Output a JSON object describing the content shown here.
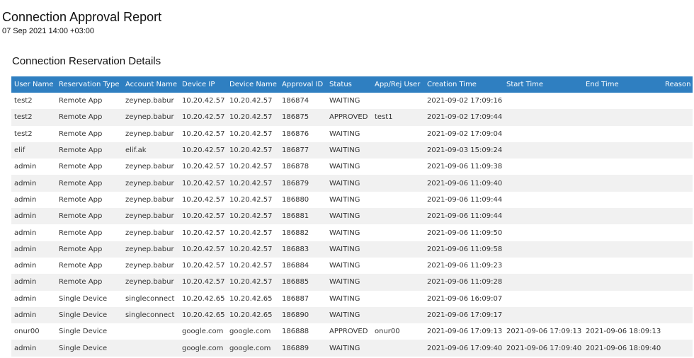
{
  "report": {
    "title": "Connection Approval Report",
    "date": "07 Sep 2021 14:00 +03:00"
  },
  "section": {
    "title": "Connection Reservation Details"
  },
  "table": {
    "columns": [
      "User Name",
      "Reservation Type",
      "Account Name",
      "Device IP",
      "Device Name",
      "Approval ID",
      "Status",
      "App/Rej User",
      "Creation Time",
      "Start Time",
      "End Time",
      "Reason"
    ],
    "rows": [
      [
        "test2",
        "Remote App",
        "zeynep.babur",
        "10.20.42.57",
        "10.20.42.57",
        "186874",
        "WAITING",
        "",
        "2021-09-02 17:09:16",
        "",
        "",
        ""
      ],
      [
        "test2",
        "Remote App",
        "zeynep.babur",
        "10.20.42.57",
        "10.20.42.57",
        "186875",
        "APPROVED",
        "test1",
        "2021-09-02 17:09:44",
        "",
        "",
        ""
      ],
      [
        "test2",
        "Remote App",
        "zeynep.babur",
        "10.20.42.57",
        "10.20.42.57",
        "186876",
        "WAITING",
        "",
        "2021-09-02 17:09:04",
        "",
        "",
        ""
      ],
      [
        "elif",
        "Remote App",
        "elif.ak",
        "10.20.42.57",
        "10.20.42.57",
        "186877",
        "WAITING",
        "",
        "2021-09-03 15:09:24",
        "",
        "",
        ""
      ],
      [
        "admin",
        "Remote App",
        "zeynep.babur",
        "10.20.42.57",
        "10.20.42.57",
        "186878",
        "WAITING",
        "",
        "2021-09-06 11:09:38",
        "",
        "",
        ""
      ],
      [
        "admin",
        "Remote App",
        "zeynep.babur",
        "10.20.42.57",
        "10.20.42.57",
        "186879",
        "WAITING",
        "",
        "2021-09-06 11:09:40",
        "",
        "",
        ""
      ],
      [
        "admin",
        "Remote App",
        "zeynep.babur",
        "10.20.42.57",
        "10.20.42.57",
        "186880",
        "WAITING",
        "",
        "2021-09-06 11:09:44",
        "",
        "",
        ""
      ],
      [
        "admin",
        "Remote App",
        "zeynep.babur",
        "10.20.42.57",
        "10.20.42.57",
        "186881",
        "WAITING",
        "",
        "2021-09-06 11:09:44",
        "",
        "",
        ""
      ],
      [
        "admin",
        "Remote App",
        "zeynep.babur",
        "10.20.42.57",
        "10.20.42.57",
        "186882",
        "WAITING",
        "",
        "2021-09-06 11:09:50",
        "",
        "",
        ""
      ],
      [
        "admin",
        "Remote App",
        "zeynep.babur",
        "10.20.42.57",
        "10.20.42.57",
        "186883",
        "WAITING",
        "",
        "2021-09-06 11:09:58",
        "",
        "",
        ""
      ],
      [
        "admin",
        "Remote App",
        "zeynep.babur",
        "10.20.42.57",
        "10.20.42.57",
        "186884",
        "WAITING",
        "",
        "2021-09-06 11:09:23",
        "",
        "",
        ""
      ],
      [
        "admin",
        "Remote App",
        "zeynep.babur",
        "10.20.42.57",
        "10.20.42.57",
        "186885",
        "WAITING",
        "",
        "2021-09-06 11:09:28",
        "",
        "",
        ""
      ],
      [
        "admin",
        "Single Device",
        "singleconnect",
        "10.20.42.65",
        "10.20.42.65",
        "186887",
        "WAITING",
        "",
        "2021-09-06 16:09:07",
        "",
        "",
        ""
      ],
      [
        "admin",
        "Single Device",
        "singleconnect",
        "10.20.42.65",
        "10.20.42.65",
        "186890",
        "WAITING",
        "",
        "2021-09-06 17:09:17",
        "",
        "",
        ""
      ],
      [
        "onur00",
        "Single Device",
        "",
        "google.com",
        "google.com",
        "186888",
        "APPROVED",
        "onur00",
        "2021-09-06 17:09:13",
        "2021-09-06 17:09:13",
        "2021-09-06 18:09:13",
        ""
      ],
      [
        "admin",
        "Single Device",
        "",
        "google.com",
        "google.com",
        "186889",
        "WAITING",
        "",
        "2021-09-06 17:09:40",
        "2021-09-06 17:09:40",
        "2021-09-06 18:09:40",
        ""
      ]
    ]
  },
  "colors": {
    "header_bg": "#2f7fc1",
    "header_text": "#ffffff",
    "stripe": "#f1f1f1"
  }
}
